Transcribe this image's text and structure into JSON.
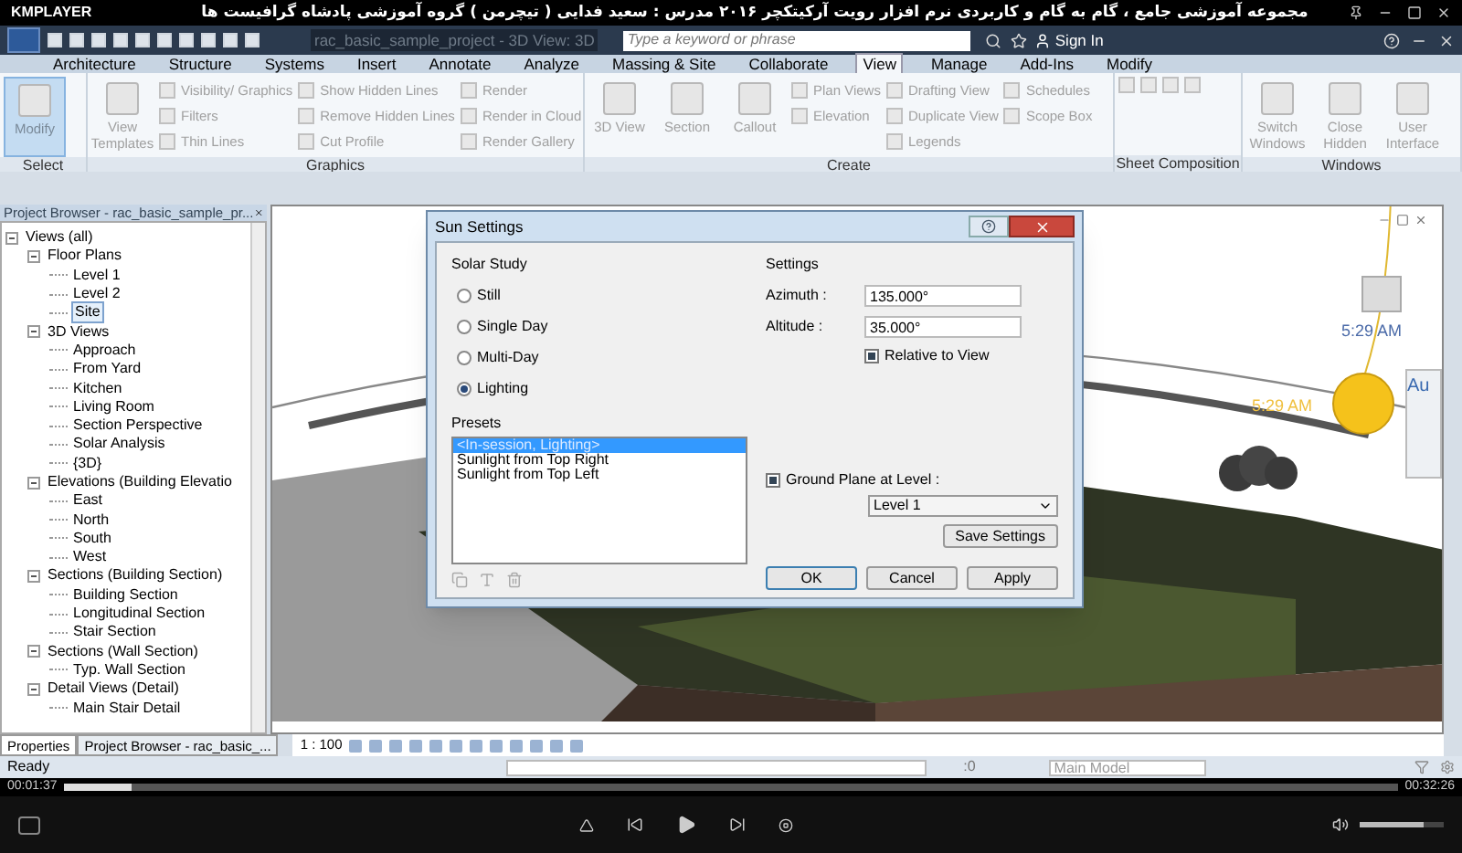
{
  "player": {
    "name": "KMPLAYER",
    "title": "مجموعه آموزشی جامع ، گام به گام و کاربردی نرم افزار رویت آرکیتکچر ۲۰۱۶   مدرس : سعید فدایی ( تیچرمن ) گروه آموزشی پادشاه گرافیست ها",
    "elapsed": "00:01:37",
    "total": "00:32:26",
    "progress": {
      "level": 0.05
    },
    "volume": {
      "level": 0.75
    }
  },
  "revit": {
    "document_title": "rac_basic_sample_project - 3D View: 3D",
    "search": {
      "placeholder": "Type a keyword or phrase"
    },
    "sign_in": "Sign In",
    "tabs": [
      {
        "label": "Architecture",
        "selected": false
      },
      {
        "label": "Structure",
        "selected": false
      },
      {
        "label": "Systems",
        "selected": false
      },
      {
        "label": "Insert",
        "selected": false
      },
      {
        "label": "Annotate",
        "selected": false
      },
      {
        "label": "Analyze",
        "selected": false
      },
      {
        "label": "Massing & Site",
        "selected": false
      },
      {
        "label": "Collaborate",
        "selected": false
      },
      {
        "label": "View",
        "selected": true
      },
      {
        "label": "Manage",
        "selected": false
      },
      {
        "label": "Add-Ins",
        "selected": false
      },
      {
        "label": "Modify",
        "selected": false
      }
    ],
    "ribbon_panels": [
      {
        "title": "Select",
        "columns": [
          {
            "kind": "large",
            "label": "Modify",
            "selected": true
          }
        ]
      },
      {
        "title": "Graphics",
        "columns": [
          {
            "kind": "large",
            "label": "View Templates",
            "selected": false
          },
          {
            "kind": "stack",
            "items": [
              {
                "label": "Visibility/ Graphics",
                "selected": false
              },
              {
                "label": "Filters",
                "selected": false
              },
              {
                "label": "Thin Lines",
                "selected": false
              }
            ]
          },
          {
            "kind": "stack",
            "items": [
              {
                "label": "Show Hidden Lines",
                "selected": false
              },
              {
                "label": "Remove Hidden Lines",
                "selected": false
              },
              {
                "label": "Cut Profile",
                "selected": false
              }
            ]
          },
          {
            "kind": "stack",
            "items": [
              {
                "label": "Render",
                "selected": false
              },
              {
                "label": "Render in Cloud",
                "selected": false
              },
              {
                "label": "Render Gallery",
                "selected": false
              }
            ]
          }
        ]
      },
      {
        "title": "Create",
        "columns": [
          {
            "kind": "large",
            "label": "3D View",
            "selected": false
          },
          {
            "kind": "large",
            "label": "Section",
            "selected": false
          },
          {
            "kind": "large",
            "label": "Callout",
            "selected": false
          },
          {
            "kind": "stack",
            "items": [
              {
                "label": "Plan Views",
                "selected": false
              },
              {
                "label": "Elevation",
                "selected": false
              }
            ]
          },
          {
            "kind": "stack",
            "items": [
              {
                "label": "Drafting View",
                "selected": false
              },
              {
                "label": "Duplicate View",
                "selected": false
              },
              {
                "label": "Legends",
                "selected": false
              }
            ]
          },
          {
            "kind": "stack",
            "items": [
              {
                "label": "Schedules",
                "selected": false
              },
              {
                "label": "Scope Box",
                "selected": false
              }
            ]
          }
        ]
      },
      {
        "title": "Sheet Composition"
      },
      {
        "title": "Windows",
        "columns": [
          {
            "kind": "large",
            "label": "Switch Windows",
            "selected": false
          },
          {
            "kind": "large",
            "label": "Close Hidden",
            "selected": false
          },
          {
            "kind": "large",
            "label": "User Interface",
            "selected": false
          }
        ]
      }
    ],
    "project_browser": {
      "title": "Project Browser - rac_basic_sample_pr...",
      "tree": [
        {
          "label": "Views (all)",
          "expanded": true,
          "selected": false,
          "children": [
            {
              "label": "Floor Plans",
              "expanded": true,
              "selected": false,
              "children": [
                {
                  "label": "Level 1",
                  "selected": false
                },
                {
                  "label": "Level 2",
                  "selected": false
                },
                {
                  "label": "Site",
                  "selected": true
                }
              ]
            },
            {
              "label": "3D Views",
              "expanded": true,
              "selected": false,
              "children": [
                {
                  "label": "Approach",
                  "selected": false
                },
                {
                  "label": "From Yard",
                  "selected": false
                },
                {
                  "label": "Kitchen",
                  "selected": false
                },
                {
                  "label": "Living Room",
                  "selected": false
                },
                {
                  "label": "Section Perspective",
                  "selected": false
                },
                {
                  "label": "Solar Analysis",
                  "selected": false
                },
                {
                  "label": "{3D}",
                  "selected": false
                }
              ]
            },
            {
              "label": "Elevations (Building Elevatio",
              "expanded": true,
              "selected": false,
              "children": [
                {
                  "label": "East",
                  "selected": false
                },
                {
                  "label": "North",
                  "selected": false
                },
                {
                  "label": "South",
                  "selected": false
                },
                {
                  "label": "West",
                  "selected": false
                }
              ]
            },
            {
              "label": "Sections (Building Section)",
              "expanded": true,
              "selected": false,
              "children": [
                {
                  "label": "Building Section",
                  "selected": false
                },
                {
                  "label": "Longitudinal Section",
                  "selected": false
                },
                {
                  "label": "Stair Section",
                  "selected": false
                }
              ]
            },
            {
              "label": "Sections (Wall Section)",
              "expanded": true,
              "selected": false,
              "children": [
                {
                  "label": "Typ. Wall Section",
                  "selected": false
                }
              ]
            },
            {
              "label": "Detail Views (Detail)",
              "expanded": true,
              "selected": false,
              "children": [
                {
                  "label": "Main Stair Detail",
                  "selected": false
                }
              ]
            }
          ]
        }
      ]
    },
    "view": {
      "scale": "1 : 100",
      "cube_time": "5:29 AM",
      "sun_time": "5:29 AM",
      "nav_label": "Au"
    },
    "sun_settings": {
      "title": "Sun Settings",
      "solar_study": {
        "title": "Solar Study",
        "options": [
          {
            "label": "Still",
            "selected": false
          },
          {
            "label": "Single Day",
            "selected": false
          },
          {
            "label": "Multi-Day",
            "selected": false
          },
          {
            "label": "Lighting",
            "selected": true
          }
        ]
      },
      "presets": {
        "title": "Presets",
        "items": [
          {
            "label": "<In-session, Lighting>",
            "selected": true
          },
          {
            "label": "Sunlight from Top Right",
            "selected": false
          },
          {
            "label": "Sunlight from Top Left",
            "selected": false
          }
        ]
      },
      "settings": {
        "title": "Settings",
        "fields": [
          {
            "label": "Azimuth :",
            "value": "135.000°"
          },
          {
            "label": "Altitude :",
            "value": "35.000°"
          }
        ],
        "relative_to_view": {
          "label": "Relative to View",
          "checked": true
        },
        "ground_plane": {
          "label": "Ground Plane at Level :",
          "checked": true
        },
        "level": "Level 1",
        "save": "Save Settings"
      },
      "buttons": [
        {
          "label": "OK",
          "kind": "default"
        },
        {
          "label": "Cancel",
          "kind": "normal"
        },
        {
          "label": "Apply",
          "kind": "normal"
        }
      ]
    },
    "bottom_tabs": [
      {
        "label": "Properties",
        "selected": true
      },
      {
        "label": "Project Browser - rac_basic_...",
        "selected": false
      }
    ],
    "status_bar": {
      "status": "Ready",
      "selection_count": ":0",
      "model": "Main Model"
    }
  }
}
